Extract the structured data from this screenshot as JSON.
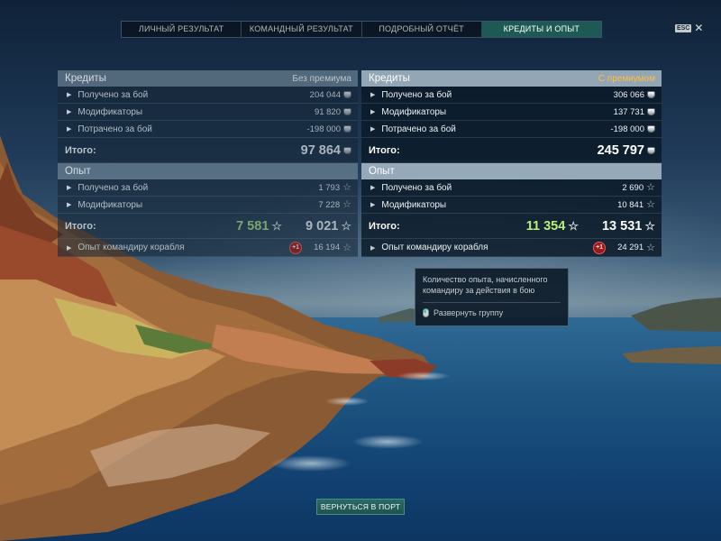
{
  "tabs": [
    {
      "label": "ЛИЧНЫЙ РЕЗУЛЬТАТ",
      "active": false
    },
    {
      "label": "КОМАНДНЫЙ РЕЗУЛЬТАТ",
      "active": false
    },
    {
      "label": "ПОДРОБНЫЙ ОТЧЁТ",
      "active": false
    },
    {
      "label": "КРЕДИТЫ И ОПЫТ",
      "active": true
    }
  ],
  "esc_label": "ESC",
  "left": {
    "credits_title": "Кредиты",
    "credits_tag": "Без премиума",
    "credit_rows": [
      {
        "label": "Получено за бой",
        "value": "204 044"
      },
      {
        "label": "Модификаторы",
        "value": "91 820"
      },
      {
        "label": "Потрачено за бой",
        "value": "-198 000"
      }
    ],
    "credits_total_label": "Итого:",
    "credits_total": "97 864",
    "xp_title": "Опыт",
    "xp_rows": [
      {
        "label": "Получено за бой",
        "value": "1 793"
      },
      {
        "label": "Модификаторы",
        "value": "7 228"
      }
    ],
    "xp_total_label": "Итого:",
    "xp_total_free": "7 581",
    "xp_total": "9 021",
    "cmdr_label": "Опыт командиру корабля",
    "cmdr_badge": "+1",
    "cmdr_value": "16 194"
  },
  "right": {
    "credits_title": "Кредиты",
    "credits_tag": "С премиумом",
    "credit_rows": [
      {
        "label": "Получено за бой",
        "value": "306 066"
      },
      {
        "label": "Модификаторы",
        "value": "137 731"
      },
      {
        "label": "Потрачено за бой",
        "value": "-198 000"
      }
    ],
    "credits_total_label": "Итого:",
    "credits_total": "245 797",
    "xp_title": "Опыт",
    "xp_rows": [
      {
        "label": "Получено за бой",
        "value": "2 690"
      },
      {
        "label": "Модификаторы",
        "value": "10 841"
      }
    ],
    "xp_total_label": "Итого:",
    "xp_total_free": "11 354",
    "xp_total": "13 531",
    "cmdr_label": "Опыт командиру корабля",
    "cmdr_badge": "+1",
    "cmdr_value": "24 291"
  },
  "tooltip": {
    "text": "Количество опыта, начисленного командиру за действия в бою",
    "action": "Развернуть группу"
  },
  "port_button": "ВЕРНУТЬСЯ В ПОРТ",
  "icons": {
    "credits": "credits-icon",
    "xp": "star-icon",
    "expand": "triangle-right-icon",
    "mouse": "mouse-icon",
    "close": "close-icon"
  },
  "colors": {
    "premium_tag": "#ffbe3f",
    "active_tab": "#1d5a55",
    "free_xp_premium": "#b9f07a",
    "free_xp_base": "#79a56e",
    "badge": "#9b1818"
  }
}
